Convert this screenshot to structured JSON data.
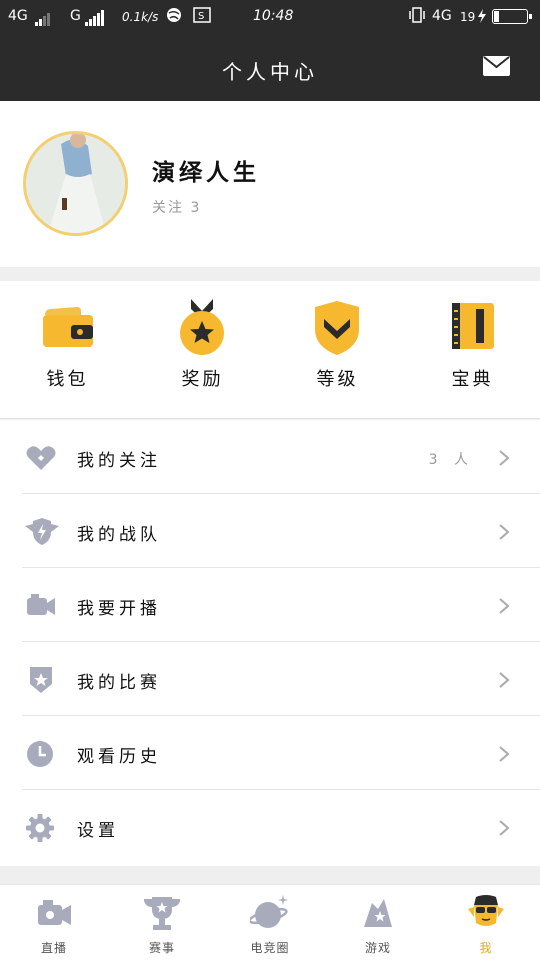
{
  "status_bar": {
    "network_1": "4G",
    "network_2": "G",
    "speed": "0.1k/s",
    "time": "10:48",
    "network_3": "4G",
    "battery": "19"
  },
  "header": {
    "title": "个人中心",
    "mail_icon": "mail-icon"
  },
  "profile": {
    "username": "演绎人生",
    "follow_note": "关注 3"
  },
  "quick_actions": [
    {
      "label": "钱包",
      "icon": "wallet-icon"
    },
    {
      "label": "奖励",
      "icon": "medal-icon"
    },
    {
      "label": "等级",
      "icon": "shield-rank-icon"
    },
    {
      "label": "宝典",
      "icon": "book-icon"
    }
  ],
  "menu": [
    {
      "label": "我的关注",
      "icon": "heart-icon",
      "count": "3 人"
    },
    {
      "label": "我的战队",
      "icon": "team-shield-icon",
      "count": ""
    },
    {
      "label": "我要开播",
      "icon": "camera-icon",
      "count": ""
    },
    {
      "label": "我的比赛",
      "icon": "match-badge-icon",
      "count": ""
    },
    {
      "label": "观看历史",
      "icon": "clock-icon",
      "count": ""
    },
    {
      "label": "设置",
      "icon": "gear-icon",
      "count": ""
    }
  ],
  "bottom_nav": [
    {
      "label": "直播",
      "icon": "live-camera-icon"
    },
    {
      "label": "赛事",
      "icon": "trophy-icon"
    },
    {
      "label": "电竞圈",
      "icon": "planet-icon"
    },
    {
      "label": "游戏",
      "icon": "game-icon"
    },
    {
      "label": "我",
      "icon": "avatar-sunglasses-icon",
      "active": true
    }
  ],
  "colors": {
    "accent": "#f5b82e",
    "header_bg": "#2b2b2b",
    "menu_icon": "#a8abbc",
    "active_tab": "#e3a82b"
  }
}
